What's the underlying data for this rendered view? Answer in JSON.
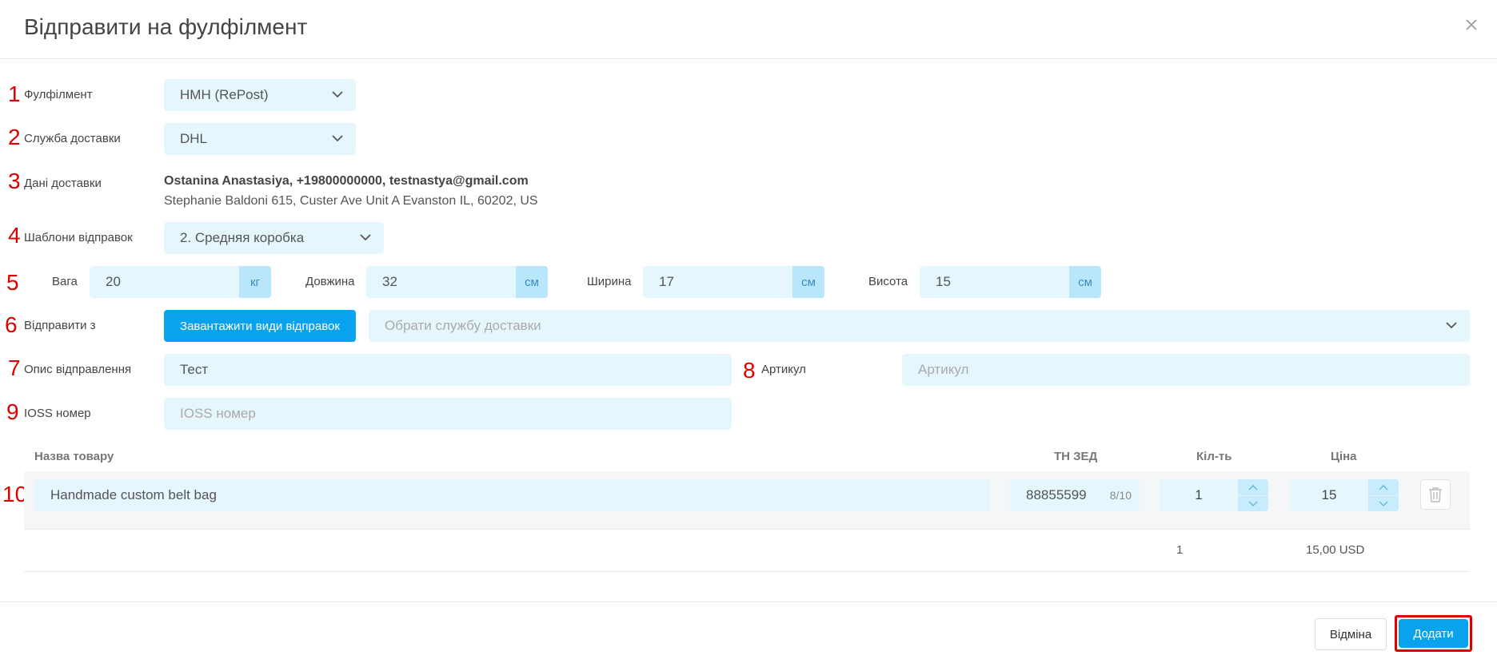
{
  "dialog": {
    "title": "Відправити на фулфілмент"
  },
  "annotations": [
    "1",
    "2",
    "3",
    "4",
    "5",
    "6",
    "7",
    "8",
    "9",
    "10"
  ],
  "form": {
    "fulfillment": {
      "label": "Фулфілмент",
      "value": "HMH (RePost)"
    },
    "delivery_service": {
      "label": "Служба доставки",
      "value": "DHL"
    },
    "delivery_data": {
      "label": "Дані доставки",
      "contact": "Ostanina Anastasiya, +19800000000, testnastya@gmail.com",
      "address": "Stephanie Baldoni 615, Custer Ave Unit A Evanston IL, 60202, US"
    },
    "templates": {
      "label": "Шаблони відправок",
      "value": "2. Средняя коробка"
    },
    "dimensions": {
      "weight": {
        "label": "Вага",
        "value": "20",
        "unit": "кг"
      },
      "length": {
        "label": "Довжина",
        "value": "32",
        "unit": "см"
      },
      "width": {
        "label": "Ширина",
        "value": "17",
        "unit": "см"
      },
      "height": {
        "label": "Висота",
        "value": "15",
        "unit": "см"
      }
    },
    "send_from": {
      "label": "Відправити з",
      "load_button": "Завантажити види відправок",
      "service_placeholder": "Обрати службу доставки"
    },
    "description": {
      "label": "Опис відправлення",
      "value": "Тест"
    },
    "article": {
      "label": "Артикул",
      "placeholder": "Артикул"
    },
    "ioss": {
      "label": "IOSS номер",
      "placeholder": "IOSS номер"
    }
  },
  "products": {
    "columns": {
      "name": "Назва товару",
      "hs_code": "ТН ЗЕД",
      "qty": "Кіл-ть",
      "price": "Ціна"
    },
    "rows": [
      {
        "name": "Handmade custom belt bag",
        "hs_code": "88855599",
        "hs_counter": "8/10",
        "qty": "1",
        "price": "15"
      }
    ],
    "totals": {
      "qty": "1",
      "price": "15,00 USD"
    }
  },
  "footer": {
    "cancel": "Відміна",
    "submit": "Додати"
  },
  "colors": {
    "accent": "#08a3ec",
    "field_bg": "#e6f6fd",
    "annotation": "#e00000"
  }
}
